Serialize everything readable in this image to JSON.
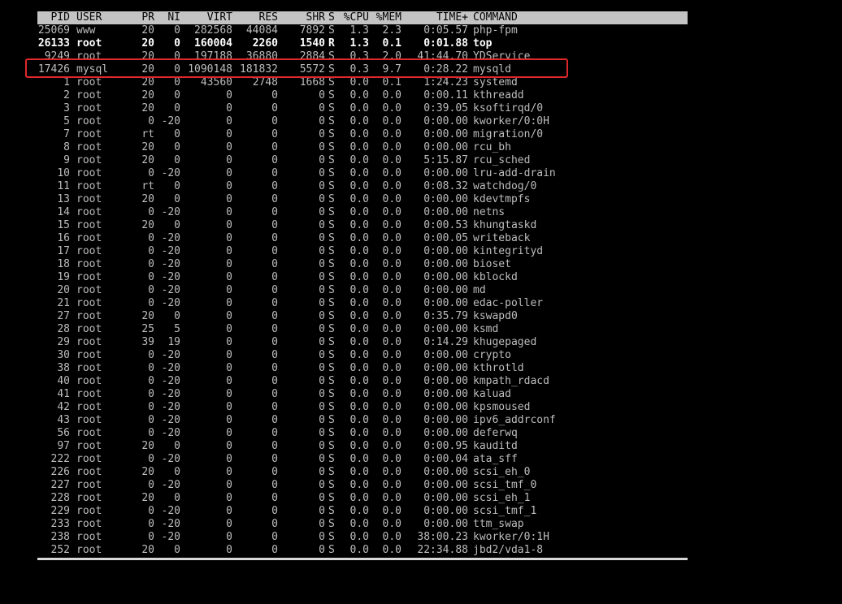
{
  "header": {
    "pid": "PID",
    "user": "USER",
    "pr": "PR",
    "ni": "NI",
    "virt": "VIRT",
    "res": "RES",
    "shr": "SHR",
    "s": "S",
    "cpu": "%CPU",
    "mem": "%MEM",
    "time": "TIME+",
    "command": "COMMAND"
  },
  "processes": [
    {
      "pid": "25069",
      "user": "www",
      "pr": "20",
      "ni": "0",
      "virt": "282568",
      "res": "44084",
      "shr": "7892",
      "s": "S",
      "cpu": "1.3",
      "mem": "2.3",
      "time": "0:05.57",
      "command": "php-fpm",
      "bold": false
    },
    {
      "pid": "26133",
      "user": "root",
      "pr": "20",
      "ni": "0",
      "virt": "160004",
      "res": "2260",
      "shr": "1540",
      "s": "R",
      "cpu": "1.3",
      "mem": "0.1",
      "time": "0:01.88",
      "command": "top",
      "bold": true
    },
    {
      "pid": "9249",
      "user": "root",
      "pr": "20",
      "ni": "0",
      "virt": "197188",
      "res": "36880",
      "shr": "2884",
      "s": "S",
      "cpu": "0.3",
      "mem": "2.0",
      "time": "41:44.70",
      "command": "YDService",
      "bold": false
    },
    {
      "pid": "17426",
      "user": "mysql",
      "pr": "20",
      "ni": "0",
      "virt": "1090148",
      "res": "181832",
      "shr": "5572",
      "s": "S",
      "cpu": "0.3",
      "mem": "9.7",
      "time": "0:28.22",
      "command": "mysqld",
      "bold": false
    },
    {
      "pid": "1",
      "user": "root",
      "pr": "20",
      "ni": "0",
      "virt": "43560",
      "res": "2748",
      "shr": "1668",
      "s": "S",
      "cpu": "0.0",
      "mem": "0.1",
      "time": "1:24.23",
      "command": "systemd",
      "bold": false
    },
    {
      "pid": "2",
      "user": "root",
      "pr": "20",
      "ni": "0",
      "virt": "0",
      "res": "0",
      "shr": "0",
      "s": "S",
      "cpu": "0.0",
      "mem": "0.0",
      "time": "0:00.11",
      "command": "kthreadd",
      "bold": false
    },
    {
      "pid": "3",
      "user": "root",
      "pr": "20",
      "ni": "0",
      "virt": "0",
      "res": "0",
      "shr": "0",
      "s": "S",
      "cpu": "0.0",
      "mem": "0.0",
      "time": "0:39.05",
      "command": "ksoftirqd/0",
      "bold": false
    },
    {
      "pid": "5",
      "user": "root",
      "pr": "0",
      "ni": "-20",
      "virt": "0",
      "res": "0",
      "shr": "0",
      "s": "S",
      "cpu": "0.0",
      "mem": "0.0",
      "time": "0:00.00",
      "command": "kworker/0:0H",
      "bold": false
    },
    {
      "pid": "7",
      "user": "root",
      "pr": "rt",
      "ni": "0",
      "virt": "0",
      "res": "0",
      "shr": "0",
      "s": "S",
      "cpu": "0.0",
      "mem": "0.0",
      "time": "0:00.00",
      "command": "migration/0",
      "bold": false
    },
    {
      "pid": "8",
      "user": "root",
      "pr": "20",
      "ni": "0",
      "virt": "0",
      "res": "0",
      "shr": "0",
      "s": "S",
      "cpu": "0.0",
      "mem": "0.0",
      "time": "0:00.00",
      "command": "rcu_bh",
      "bold": false
    },
    {
      "pid": "9",
      "user": "root",
      "pr": "20",
      "ni": "0",
      "virt": "0",
      "res": "0",
      "shr": "0",
      "s": "S",
      "cpu": "0.0",
      "mem": "0.0",
      "time": "5:15.87",
      "command": "rcu_sched",
      "bold": false
    },
    {
      "pid": "10",
      "user": "root",
      "pr": "0",
      "ni": "-20",
      "virt": "0",
      "res": "0",
      "shr": "0",
      "s": "S",
      "cpu": "0.0",
      "mem": "0.0",
      "time": "0:00.00",
      "command": "lru-add-drain",
      "bold": false
    },
    {
      "pid": "11",
      "user": "root",
      "pr": "rt",
      "ni": "0",
      "virt": "0",
      "res": "0",
      "shr": "0",
      "s": "S",
      "cpu": "0.0",
      "mem": "0.0",
      "time": "0:08.32",
      "command": "watchdog/0",
      "bold": false
    },
    {
      "pid": "13",
      "user": "root",
      "pr": "20",
      "ni": "0",
      "virt": "0",
      "res": "0",
      "shr": "0",
      "s": "S",
      "cpu": "0.0",
      "mem": "0.0",
      "time": "0:00.00",
      "command": "kdevtmpfs",
      "bold": false
    },
    {
      "pid": "14",
      "user": "root",
      "pr": "0",
      "ni": "-20",
      "virt": "0",
      "res": "0",
      "shr": "0",
      "s": "S",
      "cpu": "0.0",
      "mem": "0.0",
      "time": "0:00.00",
      "command": "netns",
      "bold": false
    },
    {
      "pid": "15",
      "user": "root",
      "pr": "20",
      "ni": "0",
      "virt": "0",
      "res": "0",
      "shr": "0",
      "s": "S",
      "cpu": "0.0",
      "mem": "0.0",
      "time": "0:00.53",
      "command": "khungtaskd",
      "bold": false
    },
    {
      "pid": "16",
      "user": "root",
      "pr": "0",
      "ni": "-20",
      "virt": "0",
      "res": "0",
      "shr": "0",
      "s": "S",
      "cpu": "0.0",
      "mem": "0.0",
      "time": "0:00.05",
      "command": "writeback",
      "bold": false
    },
    {
      "pid": "17",
      "user": "root",
      "pr": "0",
      "ni": "-20",
      "virt": "0",
      "res": "0",
      "shr": "0",
      "s": "S",
      "cpu": "0.0",
      "mem": "0.0",
      "time": "0:00.00",
      "command": "kintegrityd",
      "bold": false
    },
    {
      "pid": "18",
      "user": "root",
      "pr": "0",
      "ni": "-20",
      "virt": "0",
      "res": "0",
      "shr": "0",
      "s": "S",
      "cpu": "0.0",
      "mem": "0.0",
      "time": "0:00.00",
      "command": "bioset",
      "bold": false
    },
    {
      "pid": "19",
      "user": "root",
      "pr": "0",
      "ni": "-20",
      "virt": "0",
      "res": "0",
      "shr": "0",
      "s": "S",
      "cpu": "0.0",
      "mem": "0.0",
      "time": "0:00.00",
      "command": "kblockd",
      "bold": false
    },
    {
      "pid": "20",
      "user": "root",
      "pr": "0",
      "ni": "-20",
      "virt": "0",
      "res": "0",
      "shr": "0",
      "s": "S",
      "cpu": "0.0",
      "mem": "0.0",
      "time": "0:00.00",
      "command": "md",
      "bold": false
    },
    {
      "pid": "21",
      "user": "root",
      "pr": "0",
      "ni": "-20",
      "virt": "0",
      "res": "0",
      "shr": "0",
      "s": "S",
      "cpu": "0.0",
      "mem": "0.0",
      "time": "0:00.00",
      "command": "edac-poller",
      "bold": false
    },
    {
      "pid": "27",
      "user": "root",
      "pr": "20",
      "ni": "0",
      "virt": "0",
      "res": "0",
      "shr": "0",
      "s": "S",
      "cpu": "0.0",
      "mem": "0.0",
      "time": "0:35.79",
      "command": "kswapd0",
      "bold": false
    },
    {
      "pid": "28",
      "user": "root",
      "pr": "25",
      "ni": "5",
      "virt": "0",
      "res": "0",
      "shr": "0",
      "s": "S",
      "cpu": "0.0",
      "mem": "0.0",
      "time": "0:00.00",
      "command": "ksmd",
      "bold": false
    },
    {
      "pid": "29",
      "user": "root",
      "pr": "39",
      "ni": "19",
      "virt": "0",
      "res": "0",
      "shr": "0",
      "s": "S",
      "cpu": "0.0",
      "mem": "0.0",
      "time": "0:14.29",
      "command": "khugepaged",
      "bold": false
    },
    {
      "pid": "30",
      "user": "root",
      "pr": "0",
      "ni": "-20",
      "virt": "0",
      "res": "0",
      "shr": "0",
      "s": "S",
      "cpu": "0.0",
      "mem": "0.0",
      "time": "0:00.00",
      "command": "crypto",
      "bold": false
    },
    {
      "pid": "38",
      "user": "root",
      "pr": "0",
      "ni": "-20",
      "virt": "0",
      "res": "0",
      "shr": "0",
      "s": "S",
      "cpu": "0.0",
      "mem": "0.0",
      "time": "0:00.00",
      "command": "kthrotld",
      "bold": false
    },
    {
      "pid": "40",
      "user": "root",
      "pr": "0",
      "ni": "-20",
      "virt": "0",
      "res": "0",
      "shr": "0",
      "s": "S",
      "cpu": "0.0",
      "mem": "0.0",
      "time": "0:00.00",
      "command": "kmpath_rdacd",
      "bold": false
    },
    {
      "pid": "41",
      "user": "root",
      "pr": "0",
      "ni": "-20",
      "virt": "0",
      "res": "0",
      "shr": "0",
      "s": "S",
      "cpu": "0.0",
      "mem": "0.0",
      "time": "0:00.00",
      "command": "kaluad",
      "bold": false
    },
    {
      "pid": "42",
      "user": "root",
      "pr": "0",
      "ni": "-20",
      "virt": "0",
      "res": "0",
      "shr": "0",
      "s": "S",
      "cpu": "0.0",
      "mem": "0.0",
      "time": "0:00.00",
      "command": "kpsmoused",
      "bold": false
    },
    {
      "pid": "43",
      "user": "root",
      "pr": "0",
      "ni": "-20",
      "virt": "0",
      "res": "0",
      "shr": "0",
      "s": "S",
      "cpu": "0.0",
      "mem": "0.0",
      "time": "0:00.00",
      "command": "ipv6_addrconf",
      "bold": false
    },
    {
      "pid": "56",
      "user": "root",
      "pr": "0",
      "ni": "-20",
      "virt": "0",
      "res": "0",
      "shr": "0",
      "s": "S",
      "cpu": "0.0",
      "mem": "0.0",
      "time": "0:00.00",
      "command": "deferwq",
      "bold": false
    },
    {
      "pid": "97",
      "user": "root",
      "pr": "20",
      "ni": "0",
      "virt": "0",
      "res": "0",
      "shr": "0",
      "s": "S",
      "cpu": "0.0",
      "mem": "0.0",
      "time": "0:00.95",
      "command": "kauditd",
      "bold": false
    },
    {
      "pid": "222",
      "user": "root",
      "pr": "0",
      "ni": "-20",
      "virt": "0",
      "res": "0",
      "shr": "0",
      "s": "S",
      "cpu": "0.0",
      "mem": "0.0",
      "time": "0:00.04",
      "command": "ata_sff",
      "bold": false
    },
    {
      "pid": "226",
      "user": "root",
      "pr": "20",
      "ni": "0",
      "virt": "0",
      "res": "0",
      "shr": "0",
      "s": "S",
      "cpu": "0.0",
      "mem": "0.0",
      "time": "0:00.00",
      "command": "scsi_eh_0",
      "bold": false
    },
    {
      "pid": "227",
      "user": "root",
      "pr": "0",
      "ni": "-20",
      "virt": "0",
      "res": "0",
      "shr": "0",
      "s": "S",
      "cpu": "0.0",
      "mem": "0.0",
      "time": "0:00.00",
      "command": "scsi_tmf_0",
      "bold": false
    },
    {
      "pid": "228",
      "user": "root",
      "pr": "20",
      "ni": "0",
      "virt": "0",
      "res": "0",
      "shr": "0",
      "s": "S",
      "cpu": "0.0",
      "mem": "0.0",
      "time": "0:00.00",
      "command": "scsi_eh_1",
      "bold": false
    },
    {
      "pid": "229",
      "user": "root",
      "pr": "0",
      "ni": "-20",
      "virt": "0",
      "res": "0",
      "shr": "0",
      "s": "S",
      "cpu": "0.0",
      "mem": "0.0",
      "time": "0:00.00",
      "command": "scsi_tmf_1",
      "bold": false
    },
    {
      "pid": "233",
      "user": "root",
      "pr": "0",
      "ni": "-20",
      "virt": "0",
      "res": "0",
      "shr": "0",
      "s": "S",
      "cpu": "0.0",
      "mem": "0.0",
      "time": "0:00.00",
      "command": "ttm_swap",
      "bold": false
    },
    {
      "pid": "238",
      "user": "root",
      "pr": "0",
      "ni": "-20",
      "virt": "0",
      "res": "0",
      "shr": "0",
      "s": "S",
      "cpu": "0.0",
      "mem": "0.0",
      "time": "38:00.23",
      "command": "kworker/0:1H",
      "bold": false
    },
    {
      "pid": "252",
      "user": "root",
      "pr": "20",
      "ni": "0",
      "virt": "0",
      "res": "0",
      "shr": "0",
      "s": "S",
      "cpu": "0.0",
      "mem": "0.0",
      "time": "22:34.88",
      "command": "jbd2/vda1-8",
      "bold": false
    }
  ],
  "highlight": {
    "pid": "17426",
    "color": "#e0282c"
  },
  "colors": {
    "background": "#000000",
    "text": "#bdbdbd",
    "header_bar": "#c4c4c4",
    "header_text": "#000000",
    "bold_text": "#ffffff"
  }
}
